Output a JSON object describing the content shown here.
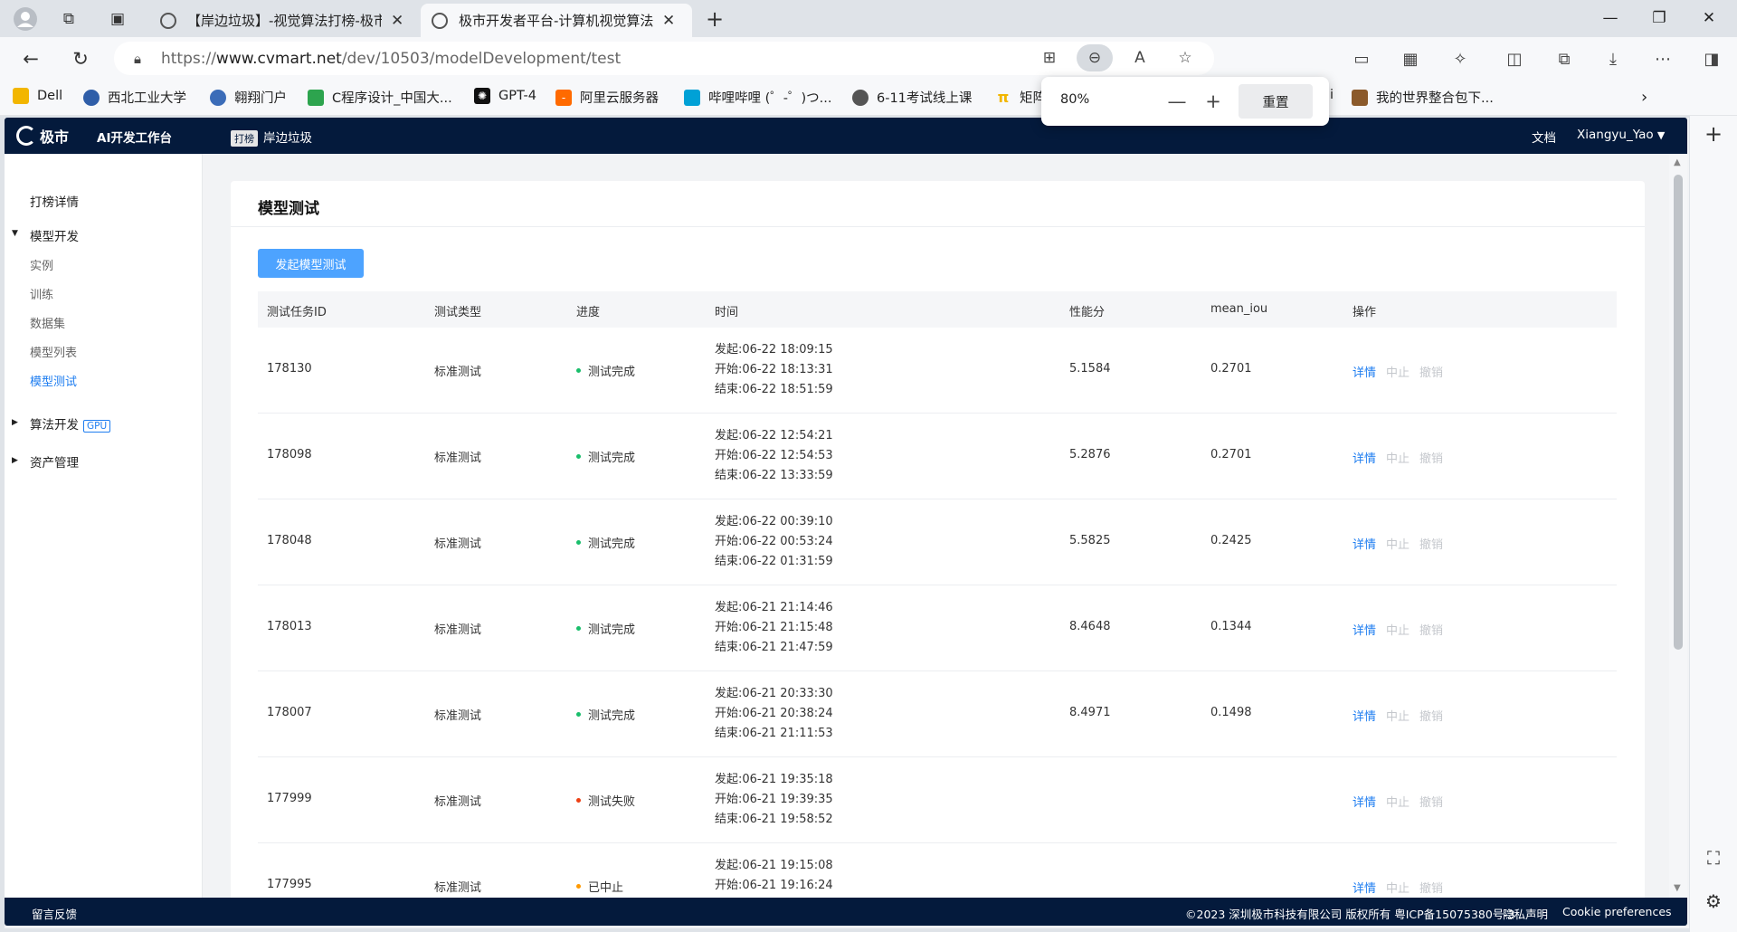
{
  "browser": {
    "tabs": [
      {
        "title": "【岸边垃圾】-视觉算法打榜-极市"
      },
      {
        "title": "极市开发者平台-计算机视觉算法"
      }
    ],
    "url": {
      "prefix": "https://",
      "domain": "www.cvmart.net",
      "path": "/dev/10503/modelDevelopment/test"
    },
    "bookmarks": [
      {
        "label": "Dell",
        "icon": "folder-icon",
        "color": "#f2b600"
      },
      {
        "label": "西北工业大学",
        "icon": "university-icon",
        "color": "#2f5ea8"
      },
      {
        "label": "翱翔门户",
        "icon": "portal-icon",
        "color": "#3b6cb8"
      },
      {
        "label": "C程序设计_中国大...",
        "icon": "mooc-icon",
        "color": "#2da44e"
      },
      {
        "label": "GPT-4",
        "icon": "openai-icon",
        "color": "#111111"
      },
      {
        "label": "阿里云服务器",
        "icon": "aliyun-icon",
        "color": "#ff6a00"
      },
      {
        "label": "哔哩哔哩 (゜-゜)つ...",
        "icon": "bilibili-icon",
        "color": "#00a1d6"
      },
      {
        "label": "6-11考试线上课",
        "icon": "globe-icon",
        "color": "#555555"
      },
      {
        "label": "矩阵",
        "icon": "pi-icon",
        "color": "#f2b600"
      },
      {
        "label": "i",
        "icon": "hidden-icon",
        "color": "#888888"
      },
      {
        "label": "我的世界整合包下...",
        "icon": "minecraft-icon",
        "color": "#8b5a2b"
      }
    ],
    "zoom": {
      "value": "80%",
      "reset_label": "重置"
    }
  },
  "site": {
    "logo_text": "极市",
    "workbench": "AI开发工作台",
    "tag": "打榜",
    "project": "岸边垃圾",
    "docs": "文档",
    "user": "Xiangyu_Yao"
  },
  "sidebar": {
    "ranking": "打榜详情",
    "model_dev": "模型开发",
    "sub": [
      "实例",
      "训练",
      "数据集",
      "模型列表",
      "模型测试"
    ],
    "algo_dev": "算法开发",
    "gpu": "GPU",
    "assets": "资产管理"
  },
  "main": {
    "title": "模型测试",
    "launch_button": "发起模型测试",
    "columns": [
      "测试任务ID",
      "测试类型",
      "进度",
      "时间",
      "性能分",
      "mean_iou",
      "操作"
    ],
    "ops": [
      "详情",
      "中止",
      "撤销"
    ],
    "rows": [
      {
        "id": "178130",
        "type": "标准测试",
        "status": "测试完成",
        "status_color": "#19be6b",
        "launch": "发起:06-22 18:09:15",
        "start": "开始:06-22 18:13:31",
        "end": "结束:06-22 18:51:59",
        "score": "5.1584",
        "iou": "0.2701"
      },
      {
        "id": "178098",
        "type": "标准测试",
        "status": "测试完成",
        "status_color": "#19be6b",
        "launch": "发起:06-22 12:54:21",
        "start": "开始:06-22 12:54:53",
        "end": "结束:06-22 13:33:59",
        "score": "5.2876",
        "iou": "0.2701"
      },
      {
        "id": "178048",
        "type": "标准测试",
        "status": "测试完成",
        "status_color": "#19be6b",
        "launch": "发起:06-22 00:39:10",
        "start": "开始:06-22 00:53:24",
        "end": "结束:06-22 01:31:59",
        "score": "5.5825",
        "iou": "0.2425"
      },
      {
        "id": "178013",
        "type": "标准测试",
        "status": "测试完成",
        "status_color": "#19be6b",
        "launch": "发起:06-21 21:14:46",
        "start": "开始:06-21 21:15:48",
        "end": "结束:06-21 21:47:59",
        "score": "8.4648",
        "iou": "0.1344"
      },
      {
        "id": "178007",
        "type": "标准测试",
        "status": "测试完成",
        "status_color": "#19be6b",
        "launch": "发起:06-21 20:33:30",
        "start": "开始:06-21 20:38:24",
        "end": "结束:06-21 21:11:53",
        "score": "8.4971",
        "iou": "0.1498"
      },
      {
        "id": "177999",
        "type": "标准测试",
        "status": "测试失败",
        "status_color": "#ed4014",
        "launch": "发起:06-21 19:35:18",
        "start": "开始:06-21 19:39:35",
        "end": "结束:06-21 19:58:52",
        "score": "",
        "iou": ""
      },
      {
        "id": "177995",
        "type": "标准测试",
        "status": "已中止",
        "status_color": "#ff9900",
        "launch": "发起:06-21 19:15:08",
        "start": "开始:06-21 19:16:24",
        "end": "",
        "score": "",
        "iou": ""
      }
    ]
  },
  "footer": {
    "feedback": "留言反馈",
    "copyright": "©2023 深圳极市科技有限公司 版权所有 粤ICP备15075380号-3",
    "privacy": "隐私声明",
    "cookie": "Cookie preferences"
  }
}
